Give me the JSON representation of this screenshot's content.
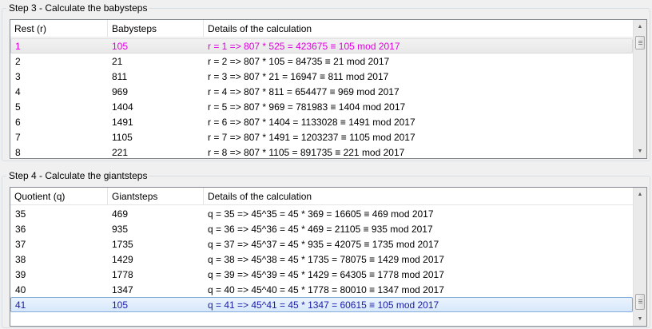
{
  "step3": {
    "title": "Step 3 - Calculate the babysteps",
    "headers": [
      "Rest (r)",
      "Babysteps",
      "Details of the calculation"
    ],
    "row_color": "#e000e0",
    "rows": [
      [
        "1",
        "105",
        "r = 1 => 807 * 525 = 423675 ≡ 105 mod 2017"
      ],
      [
        "2",
        "21",
        "r = 2 => 807 * 105 = 84735 ≡ 21 mod 2017"
      ],
      [
        "3",
        "811",
        "r = 3 => 807 * 21 = 16947 ≡ 811 mod 2017"
      ],
      [
        "4",
        "969",
        "r = 4 => 807 * 811 = 654477 ≡ 969 mod 2017"
      ],
      [
        "5",
        "1404",
        "r = 5 => 807 * 969 = 781983 ≡ 1404 mod 2017"
      ],
      [
        "6",
        "1491",
        "r = 6 => 807 * 1404 = 1133028 ≡ 1491 mod 2017"
      ],
      [
        "7",
        "1105",
        "r = 7 => 807 * 1491 = 1203237 ≡ 1105 mod 2017"
      ],
      [
        "8",
        "221",
        "r = 8 => 807 * 1105 = 891735 ≡ 221 mod 2017"
      ]
    ]
  },
  "step4": {
    "title": "Step 4 - Calculate the giantsteps",
    "headers": [
      "Quotient (q)",
      "Giantsteps",
      "Details of the calculation"
    ],
    "row_color": "#1a1aa8",
    "rows": [
      [
        "35",
        "469",
        "q = 35 => 45^35 = 45 * 369 = 16605 ≡ 469 mod 2017"
      ],
      [
        "36",
        "935",
        "q = 36 => 45^36 = 45 * 469 = 21105 ≡ 935 mod 2017"
      ],
      [
        "37",
        "1735",
        "q = 37 => 45^37 = 45 * 935 = 42075 ≡ 1735 mod 2017"
      ],
      [
        "38",
        "1429",
        "q = 38 => 45^38 = 45 * 1735 = 78075 ≡ 1429 mod 2017"
      ],
      [
        "39",
        "1778",
        "q = 39 => 45^39 = 45 * 1429 = 64305 ≡ 1778 mod 2017"
      ],
      [
        "40",
        "1347",
        "q = 40 => 45^40 = 45 * 1778 = 80010 ≡ 1347 mod 2017"
      ],
      [
        "41",
        "105",
        "q = 41 => 45^41 = 45 * 1347 = 60615 ≡ 105 mod 2017"
      ]
    ]
  },
  "icons": {
    "scroll_up": "▲",
    "scroll_down": "▼"
  }
}
